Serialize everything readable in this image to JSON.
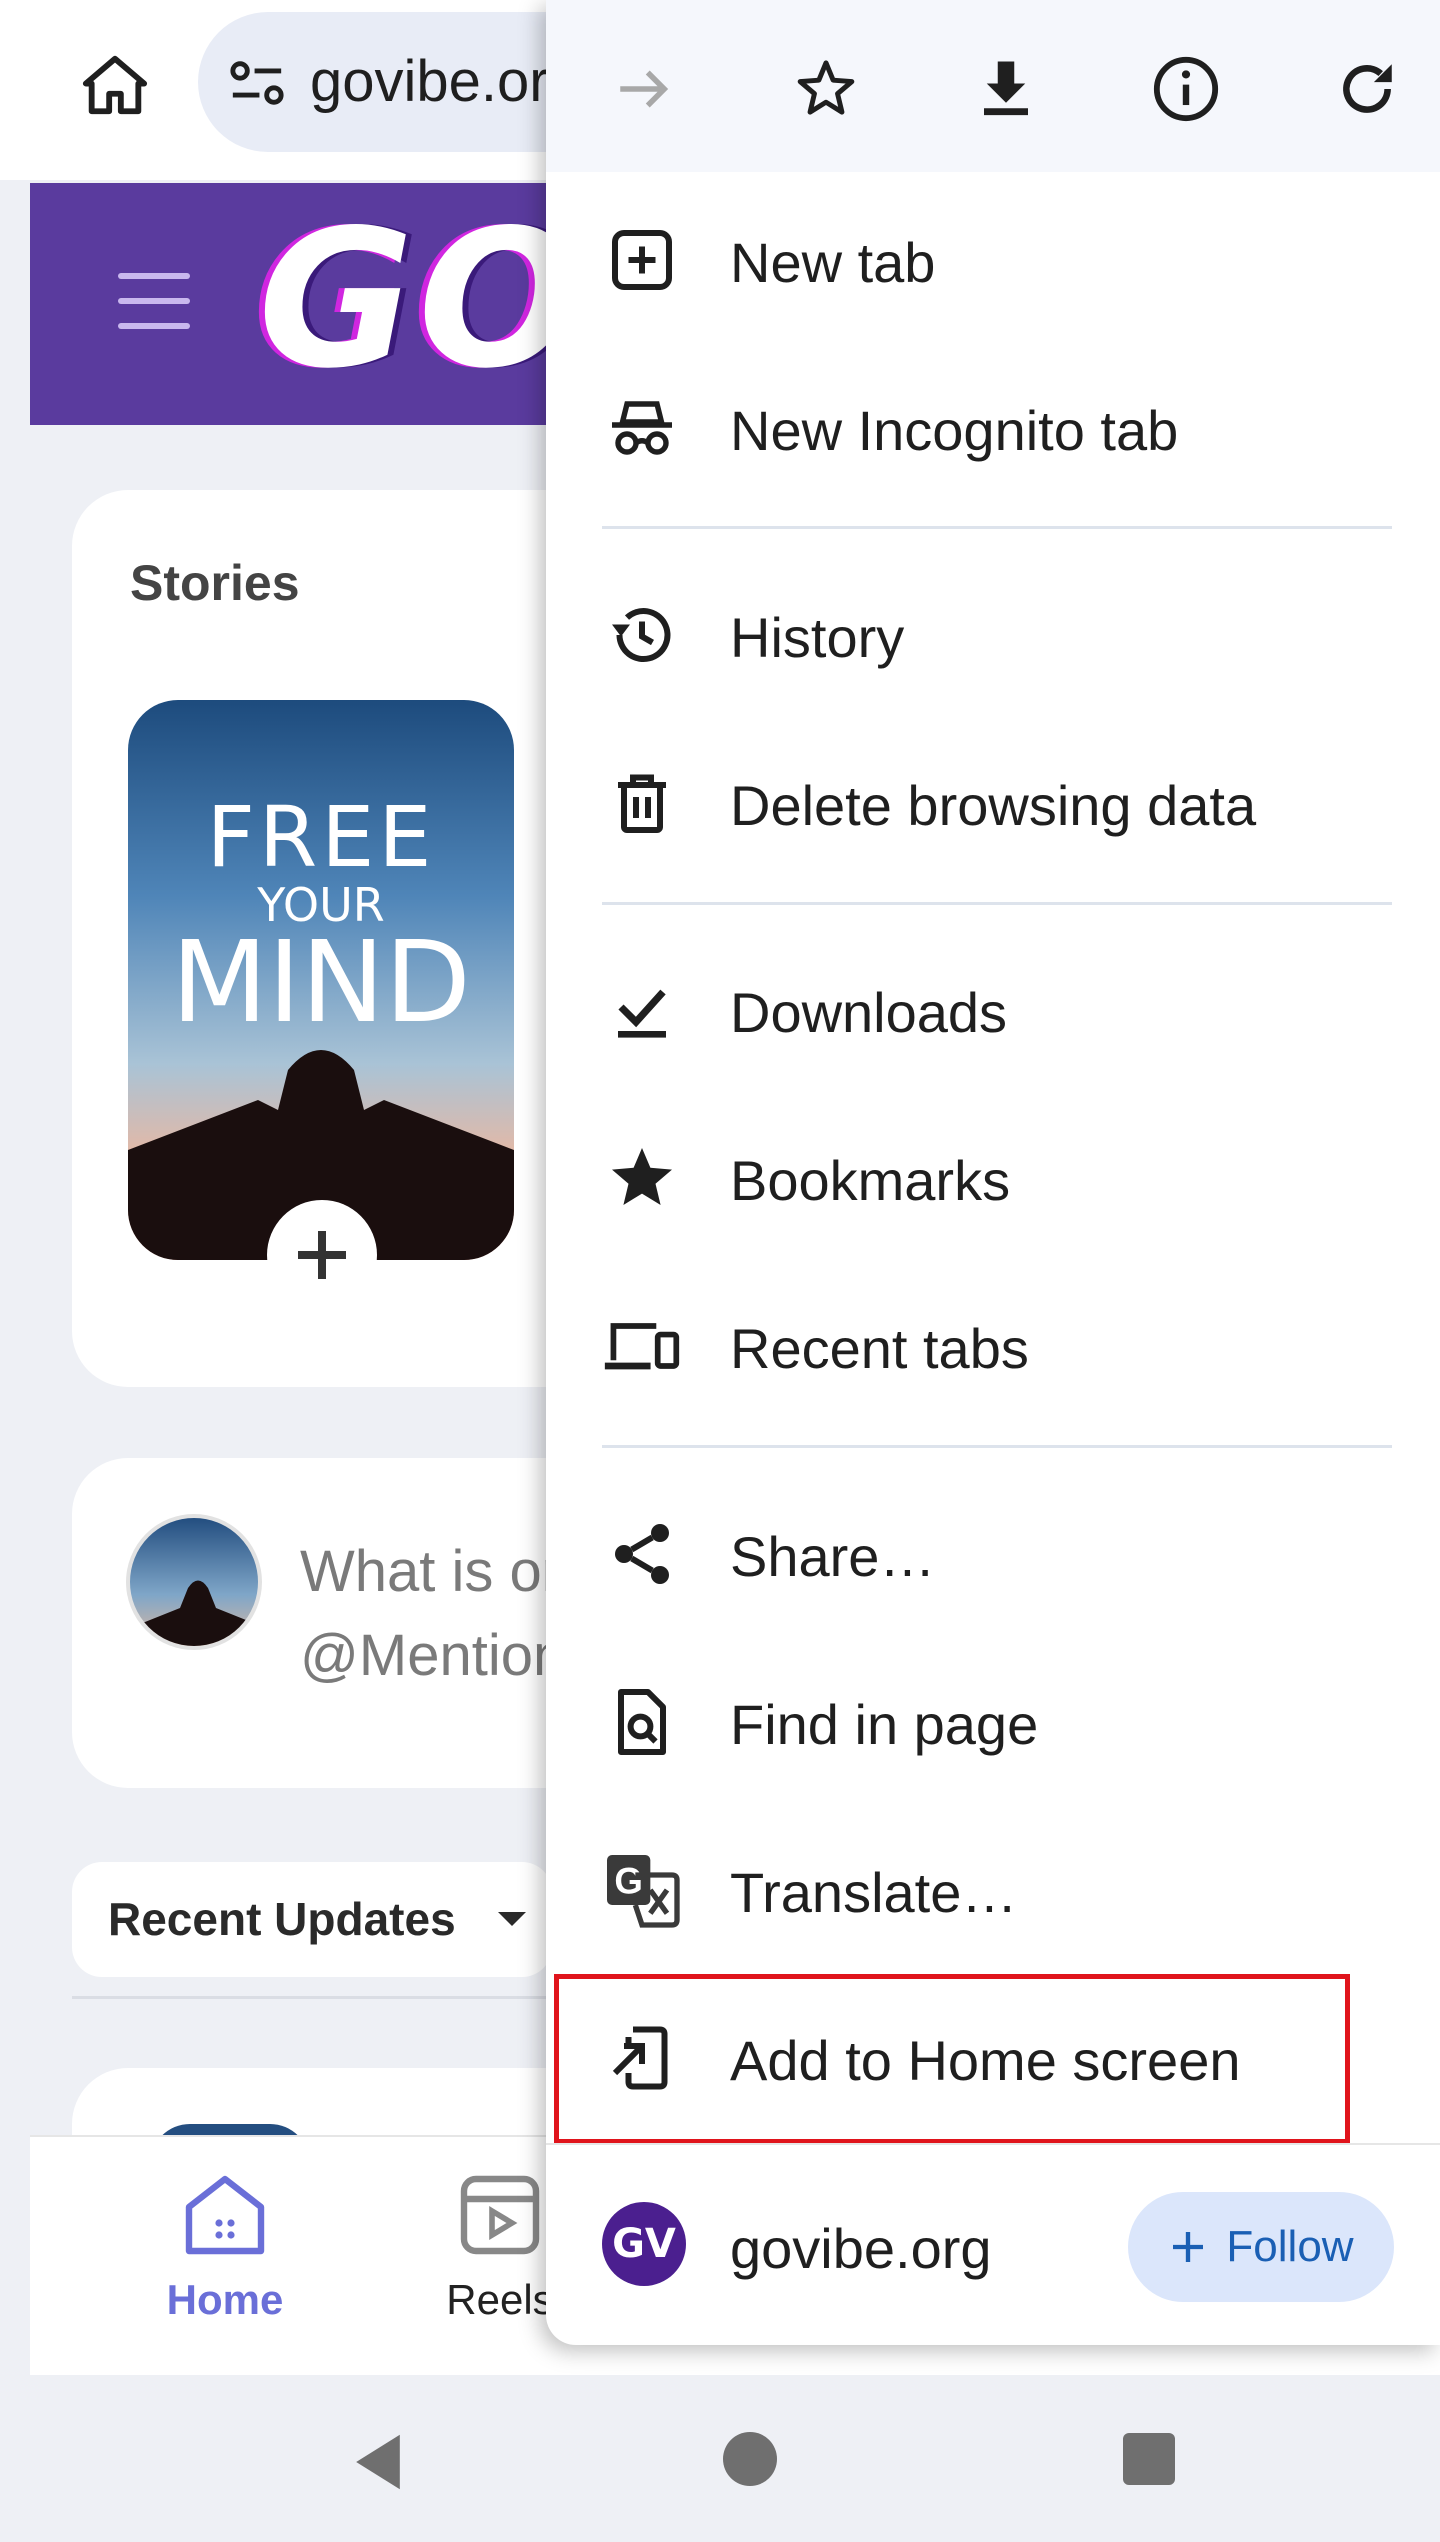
{
  "browser": {
    "url": "govibe.org",
    "icons": {
      "home": "home-icon",
      "site_settings": "tune-icon"
    }
  },
  "site": {
    "logo": "GOVIBE",
    "stories_title": "Stories",
    "story_image_text": {
      "line1": "FREE",
      "line2": "YOUR",
      "line3": "MIND"
    },
    "post_placeholder": "What is on your mind? #Hashtag..\n@Mention..",
    "recent_updates_label": "Recent Updates",
    "nav": {
      "home": "Home",
      "reels": "Reels"
    },
    "colors": {
      "header": "#5a3b9e",
      "nav_active": "#6a6fd8"
    }
  },
  "menu": {
    "toolbar": [
      "forward-icon",
      "bookmark-star-icon",
      "download-icon",
      "info-icon",
      "reload-icon"
    ],
    "items": [
      {
        "label": "New tab",
        "icon": "new-tab-icon"
      },
      {
        "label": "New Incognito tab",
        "icon": "incognito-icon"
      },
      {
        "label": "History",
        "icon": "history-icon"
      },
      {
        "label": "Delete browsing data",
        "icon": "trash-icon"
      },
      {
        "label": "Downloads",
        "icon": "downloads-icon"
      },
      {
        "label": "Bookmarks",
        "icon": "star-icon"
      },
      {
        "label": "Recent tabs",
        "icon": "devices-icon"
      },
      {
        "label": "Share…",
        "icon": "share-icon"
      },
      {
        "label": "Find in page",
        "icon": "find-icon"
      },
      {
        "label": "Translate…",
        "icon": "translate-icon"
      },
      {
        "label": "Add to Home screen",
        "icon": "add-to-home-icon"
      }
    ],
    "site_row": {
      "favicon_text": "GV",
      "name": "govibe.org",
      "follow_label": "Follow"
    },
    "highlight_color": "#e0141c"
  }
}
